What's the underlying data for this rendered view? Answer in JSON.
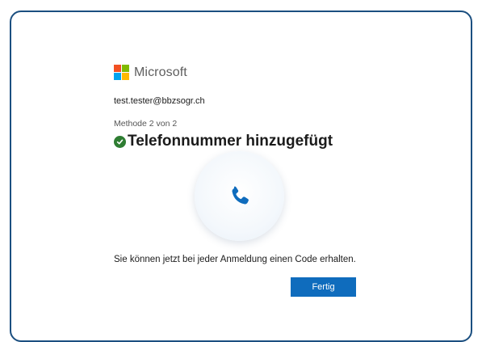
{
  "brand": {
    "name": "Microsoft",
    "logo_colors": [
      "#f25022",
      "#7fba00",
      "#00a4ef",
      "#ffb900"
    ]
  },
  "account": {
    "email": "test.tester@bbzsogr.ch"
  },
  "step": {
    "progress": "Methode 2 von 2",
    "title": "Telefonnummer hinzugefügt",
    "status_icon": "check-circle-icon",
    "status_color": "#2e7d32"
  },
  "illustration": {
    "icon": "phone-icon",
    "color": "#0f6cbd"
  },
  "message": "Sie können jetzt bei jeder Anmeldung einen Code erhalten.",
  "actions": {
    "done_label": "Fertig",
    "accent": "#0f6cbd"
  }
}
